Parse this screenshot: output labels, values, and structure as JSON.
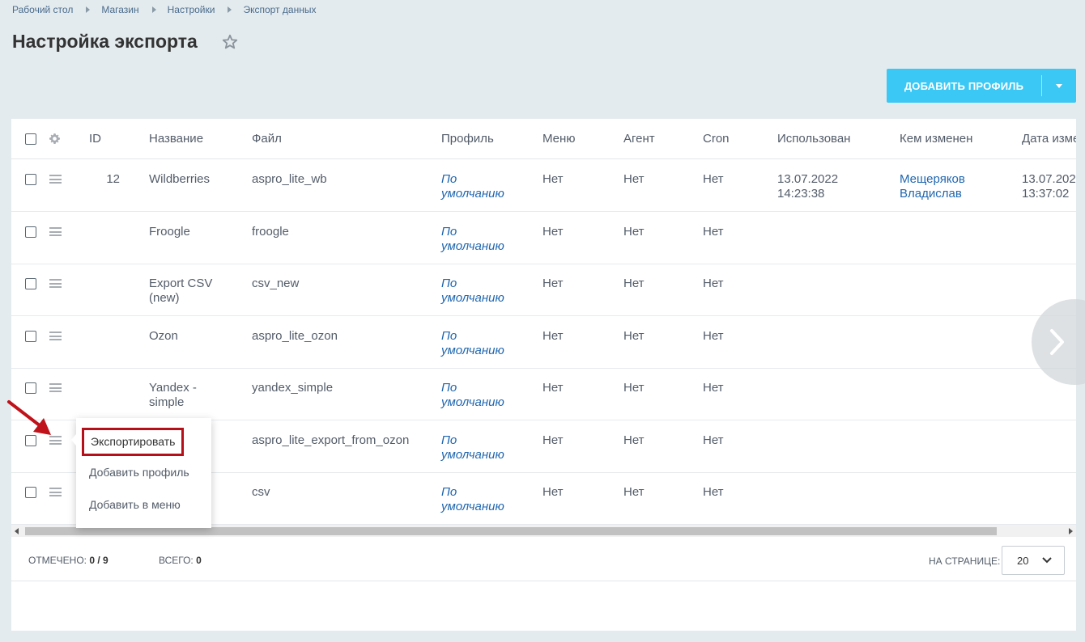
{
  "breadcrumb": [
    "Рабочий стол",
    "Магазин",
    "Настройки",
    "Экспорт данных"
  ],
  "page": {
    "title": "Настройка экспорта"
  },
  "toolbar": {
    "add_profile_label": "ДОБАВИТЬ ПРОФИЛЬ"
  },
  "table": {
    "headers": {
      "id": "ID",
      "name": "Название",
      "file": "Файл",
      "profile": "Профиль",
      "menu": "Меню",
      "agent": "Агент",
      "cron": "Cron",
      "used": "Использован",
      "changed_by": "Кем изменен",
      "date": "Дата изме"
    },
    "rows": [
      {
        "id": "12",
        "name_1": "Wildberries",
        "name_2": "",
        "file": "aspro_lite_wb",
        "profile_1": "По",
        "profile_2": "умолчанию",
        "menu": "Нет",
        "agent": "Нет",
        "cron": "Нет",
        "used_1": "13.07.2022",
        "used_2": "14:23:38",
        "changed_by_1": "Мещеряков",
        "changed_by_2": "Владислав",
        "date_1": "13.07.202",
        "date_2": "13:37:02"
      },
      {
        "id": "",
        "name_1": "Froogle",
        "name_2": "",
        "file": "froogle",
        "profile_1": "По",
        "profile_2": "умолчанию",
        "menu": "Нет",
        "agent": "Нет",
        "cron": "Нет",
        "used_1": "",
        "used_2": "",
        "changed_by_1": "",
        "changed_by_2": "",
        "date_1": "",
        "date_2": ""
      },
      {
        "id": "",
        "name_1": "Export CSV",
        "name_2": "(new)",
        "file": "csv_new",
        "profile_1": "По",
        "profile_2": "умолчанию",
        "menu": "Нет",
        "agent": "Нет",
        "cron": "Нет",
        "used_1": "",
        "used_2": "",
        "changed_by_1": "",
        "changed_by_2": "",
        "date_1": "",
        "date_2": ""
      },
      {
        "id": "",
        "name_1": "Ozon",
        "name_2": "",
        "file": "aspro_lite_ozon",
        "profile_1": "По",
        "profile_2": "умолчанию",
        "menu": "Нет",
        "agent": "Нет",
        "cron": "Нет",
        "used_1": "",
        "used_2": "",
        "changed_by_1": "",
        "changed_by_2": "",
        "date_1": "",
        "date_2": ""
      },
      {
        "id": "",
        "name_1": "Yandex -",
        "name_2": "simple",
        "file": "yandex_simple",
        "profile_1": "По",
        "profile_2": "умолчанию",
        "menu": "Нет",
        "agent": "Нет",
        "cron": "Нет",
        "used_1": "",
        "used_2": "",
        "changed_by_1": "",
        "changed_by_2": "",
        "date_1": "",
        "date_2": ""
      },
      {
        "id": "",
        "name_1": "",
        "name_2": "",
        "file": "aspro_lite_export_from_ozon",
        "profile_1": "По",
        "profile_2": "умолчанию",
        "menu": "Нет",
        "agent": "Нет",
        "cron": "Нет",
        "used_1": "",
        "used_2": "",
        "changed_by_1": "",
        "changed_by_2": "",
        "date_1": "",
        "date_2": ""
      },
      {
        "id": "",
        "name_1": "",
        "name_2": "",
        "file": "csv",
        "profile_1": "По",
        "profile_2": "умолчанию",
        "menu": "Нет",
        "agent": "Нет",
        "cron": "Нет",
        "used_1": "",
        "used_2": "",
        "changed_by_1": "",
        "changed_by_2": "",
        "date_1": "",
        "date_2": ""
      }
    ]
  },
  "footer": {
    "selected_label": "ОТМЕЧЕНО:",
    "selected_value": "0 / 9",
    "total_label": "ВСЕГО:",
    "total_value": "0",
    "per_page_label": "НА СТРАНИЦЕ:",
    "per_page_value": "20"
  },
  "context_menu": {
    "items": [
      "Экспортировать",
      "Добавить профиль",
      "Добавить в меню"
    ]
  },
  "colors": {
    "accent": "#3bc8f5",
    "link": "#2067b0",
    "highlight": "#b5101a",
    "background": "#e4ebee"
  }
}
